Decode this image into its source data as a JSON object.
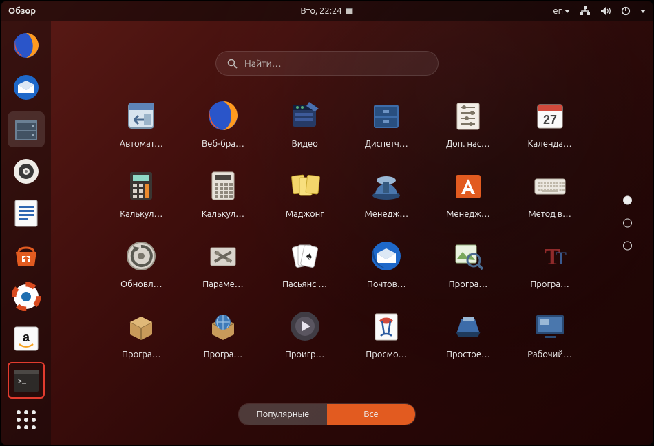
{
  "top": {
    "activities": "Обзор",
    "clock": "Вто, 22:24",
    "lang": "en"
  },
  "search": {
    "placeholder": "Найти…"
  },
  "tabs": {
    "popular": "Популярные",
    "all": "Все",
    "active": "all"
  },
  "dock": [
    {
      "name": "firefox"
    },
    {
      "name": "thunderbird"
    },
    {
      "name": "files",
      "active": true
    },
    {
      "name": "rhythmbox"
    },
    {
      "name": "writer"
    },
    {
      "name": "software"
    },
    {
      "name": "help"
    },
    {
      "name": "amazon"
    },
    {
      "name": "terminal",
      "highlight": true
    }
  ],
  "page": {
    "current": 1,
    "total": 3
  },
  "apps": [
    {
      "label": "Автомат…",
      "icon": "autorun"
    },
    {
      "label": "Веб-бра…",
      "icon": "firefox"
    },
    {
      "label": "Видео",
      "icon": "video"
    },
    {
      "label": "Диспетч…",
      "icon": "archive"
    },
    {
      "label": "Доп. нас…",
      "icon": "tweaks"
    },
    {
      "label": "Календа…",
      "icon": "calendar",
      "badge": "27"
    },
    {
      "label": "Калькул…",
      "icon": "calc-dark"
    },
    {
      "label": "Калькул…",
      "icon": "calc-light"
    },
    {
      "label": "Маджонг",
      "icon": "mahjong"
    },
    {
      "label": "Менедж…",
      "icon": "scanner-blue"
    },
    {
      "label": "Менедж…",
      "icon": "a-orange"
    },
    {
      "label": "Метод в…",
      "icon": "keyboard"
    },
    {
      "label": "Обновл…",
      "icon": "updater"
    },
    {
      "label": "Параме…",
      "icon": "settings"
    },
    {
      "label": "Пасьянс …",
      "icon": "cards"
    },
    {
      "label": "Почтов…",
      "icon": "thunderbird"
    },
    {
      "label": "Програ…",
      "icon": "magnify-img"
    },
    {
      "label": "Програ…",
      "icon": "fonts"
    },
    {
      "label": "Програ…",
      "icon": "box"
    },
    {
      "label": "Програ…",
      "icon": "box-globe"
    },
    {
      "label": "Проигр…",
      "icon": "player"
    },
    {
      "label": "Просмо…",
      "icon": "evince"
    },
    {
      "label": "Простое…",
      "icon": "scan-flat"
    },
    {
      "label": "Рабочий…",
      "icon": "remote"
    }
  ]
}
